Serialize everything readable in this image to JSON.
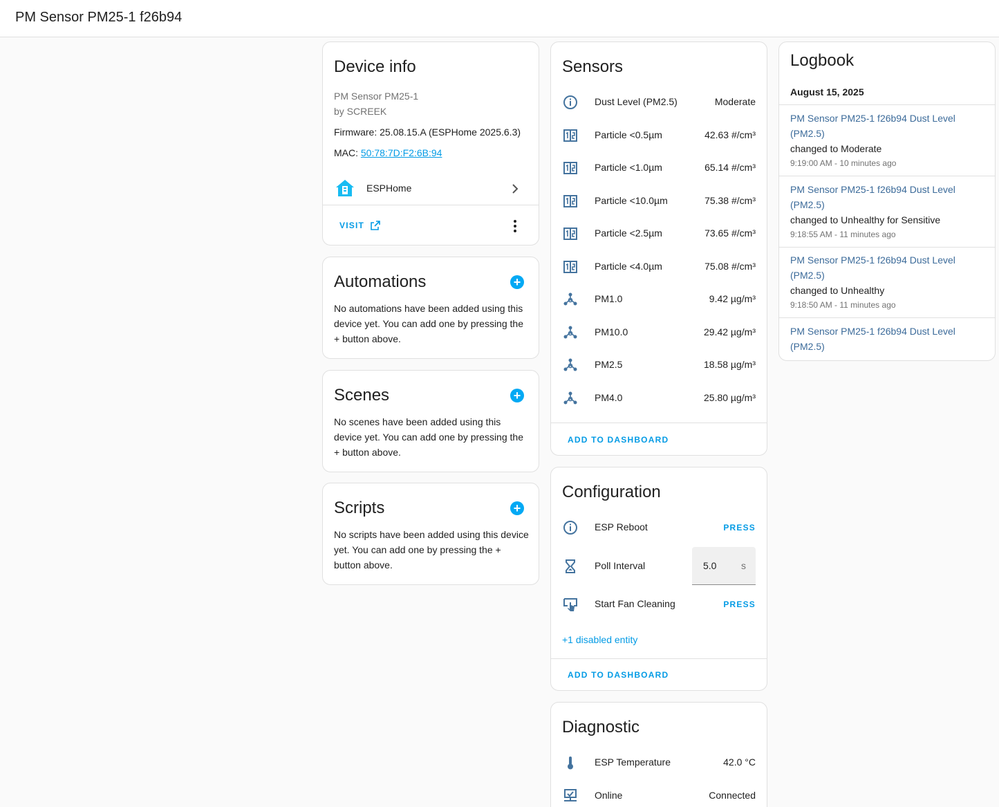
{
  "header": {
    "title": "PM Sensor PM25-1 f26b94"
  },
  "device_info": {
    "title": "Device info",
    "model": "PM Sensor PM25-1",
    "manufacturer": "by SCREEK",
    "firmware": "Firmware: 25.08.15.A (ESPHome 2025.6.3)",
    "mac_label": "MAC: ",
    "mac_value": "50:78:7D:F2:6B:94",
    "integration": "ESPHome",
    "visit_label": "VISIT"
  },
  "automations": {
    "title": "Automations",
    "text": "No automations have been added using this device yet. You can add one by pressing the + button above."
  },
  "scenes": {
    "title": "Scenes",
    "text": "No scenes have been added using this device yet. You can add one by pressing the + button above."
  },
  "scripts": {
    "title": "Scripts",
    "text": "No scripts have been added using this device yet. You can add one by pressing the + button above."
  },
  "sensors": {
    "title": "Sensors",
    "items": [
      {
        "name": "Dust Level (PM2.5)",
        "value": "Moderate",
        "icon": "info-icon"
      },
      {
        "name": "Particle <0.5µm",
        "value": "42.63 #/cm³",
        "icon": "counter-icon"
      },
      {
        "name": "Particle <1.0µm",
        "value": "65.14 #/cm³",
        "icon": "counter-icon"
      },
      {
        "name": "Particle <10.0µm",
        "value": "75.38 #/cm³",
        "icon": "counter-icon"
      },
      {
        "name": "Particle <2.5µm",
        "value": "73.65 #/cm³",
        "icon": "counter-icon"
      },
      {
        "name": "Particle <4.0µm",
        "value": "75.08 #/cm³",
        "icon": "counter-icon"
      },
      {
        "name": "PM1.0",
        "value": "9.42 µg/m³",
        "icon": "molecule-icon"
      },
      {
        "name": "PM10.0",
        "value": "29.42 µg/m³",
        "icon": "molecule-icon"
      },
      {
        "name": "PM2.5",
        "value": "18.58 µg/m³",
        "icon": "molecule-icon"
      },
      {
        "name": "PM4.0",
        "value": "25.80 µg/m³",
        "icon": "molecule-icon"
      }
    ],
    "add_label": "ADD TO DASHBOARD"
  },
  "configuration": {
    "title": "Configuration",
    "reboot_name": "ESP Reboot",
    "reboot_action": "PRESS",
    "poll_name": "Poll Interval",
    "poll_value": "5.0",
    "poll_unit": "s",
    "fan_name": "Start Fan Cleaning",
    "fan_action": "PRESS",
    "disabled_label": "+1 disabled entity",
    "add_label": "ADD TO DASHBOARD"
  },
  "diagnostic": {
    "title": "Diagnostic",
    "items": [
      {
        "name": "ESP Temperature",
        "value": "42.0 °C",
        "icon": "thermometer-icon"
      },
      {
        "name": "Online",
        "value": "Connected",
        "icon": "lan-connect-icon"
      }
    ]
  },
  "logbook": {
    "title": "Logbook",
    "date": "August 15, 2025",
    "entries": [
      {
        "entity": "PM Sensor PM25-1 f26b94 Dust Level (PM2.5)",
        "change": "changed to Moderate",
        "time": "9:19:00 AM - 10 minutes ago"
      },
      {
        "entity": "PM Sensor PM25-1 f26b94 Dust Level (PM2.5)",
        "change": "changed to Unhealthy for Sensitive",
        "time": "9:18:55 AM - 11 minutes ago"
      },
      {
        "entity": "PM Sensor PM25-1 f26b94 Dust Level (PM2.5)",
        "change": "changed to Unhealthy",
        "time": "9:18:50 AM - 11 minutes ago"
      },
      {
        "entity": "PM Sensor PM25-1 f26b94 Dust Level (PM2.5)",
        "change": "",
        "time": ""
      }
    ]
  },
  "colors": {
    "accent": "#03a9f4",
    "icon": "#44739e",
    "link": "#039be5"
  }
}
